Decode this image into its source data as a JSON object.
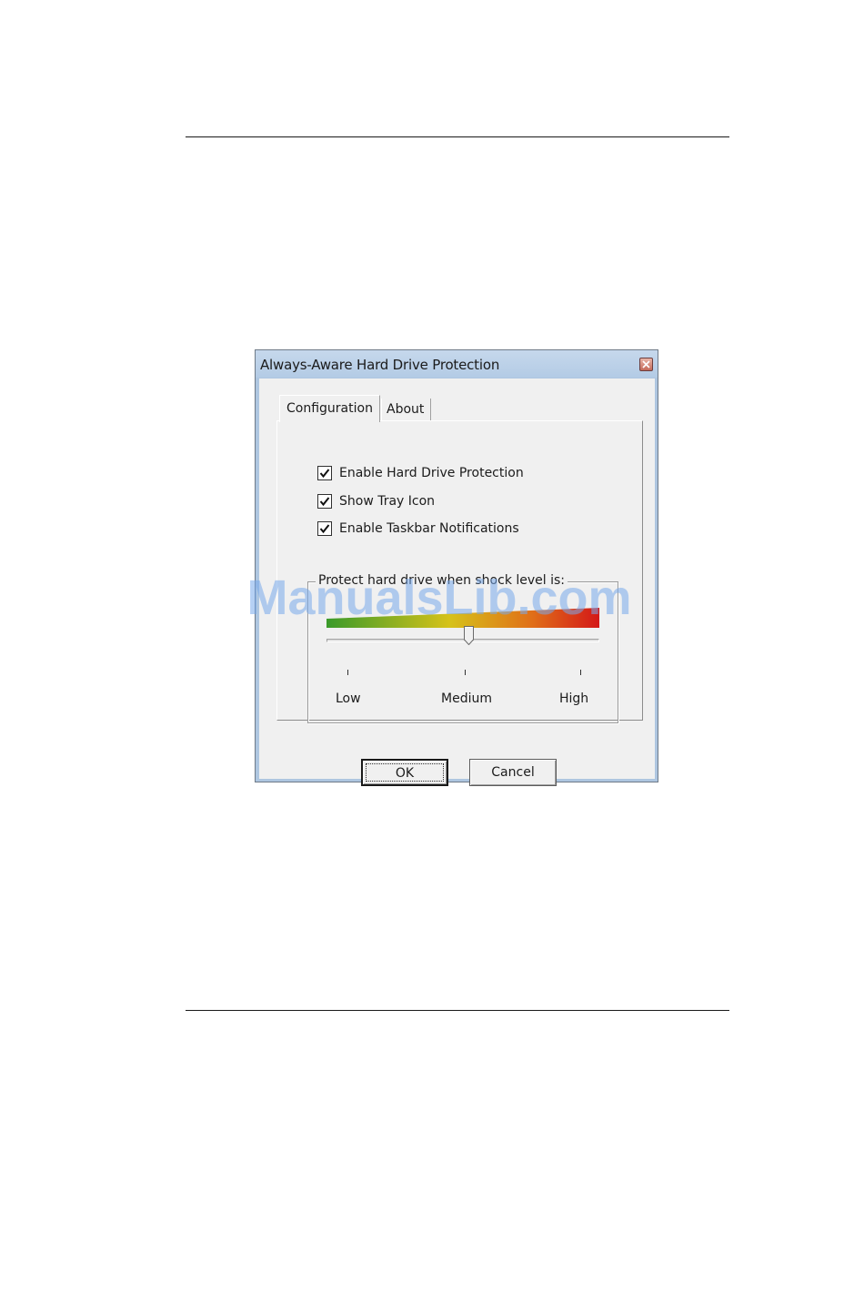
{
  "dialog": {
    "title": "Always-Aware Hard Drive Protection",
    "close_icon": "close-x-icon"
  },
  "tabs": [
    {
      "label": "Configuration",
      "selected": true
    },
    {
      "label": "About",
      "selected": false
    }
  ],
  "options": [
    {
      "label": "Enable Hard Drive Protection",
      "checked": true
    },
    {
      "label": "Show Tray Icon",
      "checked": true
    },
    {
      "label": "Enable Taskbar Notifications",
      "checked": true
    }
  ],
  "shock_group": {
    "label": "Protect hard drive when shock level is:",
    "gradient_colors": [
      "#3a9a2a",
      "#d6c21a",
      "#e07018",
      "#d41818"
    ],
    "slider_level": "Medium",
    "scale_labels": [
      "Low",
      "Medium",
      "High"
    ]
  },
  "buttons": {
    "ok_label": "OK",
    "cancel_label": "Cancel"
  },
  "watermark": "ManualsLib.com"
}
